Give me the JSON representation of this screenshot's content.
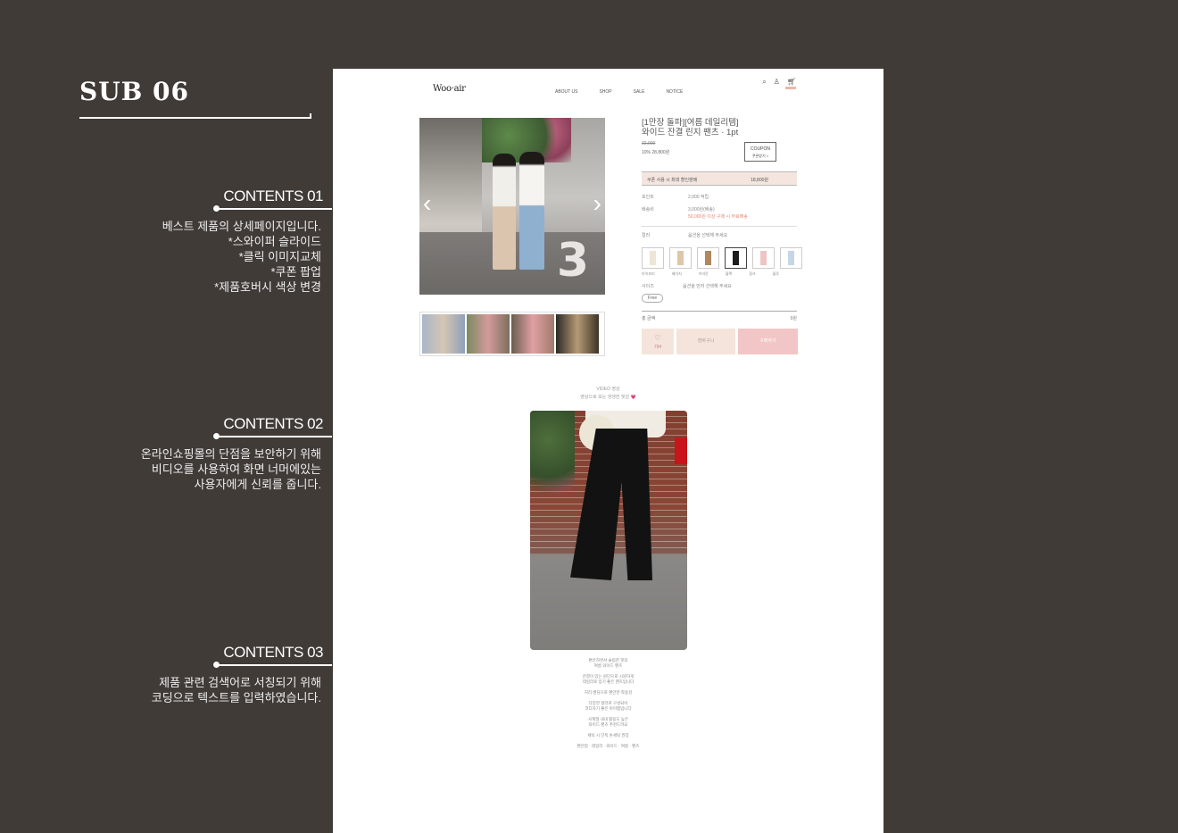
{
  "panel": {
    "title": "SUB 06",
    "sections": [
      {
        "heading": "CONTENTS 01",
        "lines": [
          "베스트 제품의 상세페이지입니다.",
          "*스와이퍼 슬라이드",
          "*클릭 이미지교체",
          "*쿠폰 팝업",
          "*제품호버시 색상 변경"
        ]
      },
      {
        "heading": "CONTENTS 02",
        "lines": [
          "온라인쇼핑몰의  단점을 보안하기 위해",
          "비디오를 사용하여 화면 너머에있는",
          "사용자에게 신뢰를 줍니다."
        ]
      },
      {
        "heading": "CONTENTS 03",
        "lines": [
          "제품 관련 검색어로 서칭되기 위해",
          "코딩으로 텍스트를 입력하였습니다."
        ]
      }
    ]
  },
  "site": {
    "logo": "Woo·air",
    "nav": [
      "ABOUT US",
      "SHOP",
      "SALE",
      "NOTICE"
    ],
    "icons": [
      "search-icon",
      "user-icon",
      "cart-icon"
    ]
  },
  "product": {
    "title_line1": "[1만장 돌파][여름 데일리템]",
    "title_line2": "와이드 잔결 린지 팬츠 · 1pt",
    "price_orig": "32,000",
    "price_sale": "10% 28,800원",
    "coupon_label": "COUPON",
    "coupon_sub": "쿠폰받기 >",
    "pink_bar_left": "쿠폰 사용 시 최대 할인판매",
    "pink_bar_right": "18,800원",
    "rows": [
      {
        "label": "포인트",
        "value": "2,000 적립"
      },
      {
        "label": "배송비",
        "value": "3,000원(배송)"
      }
    ],
    "row_note": "50,000원 이상 구매 시 무료배송",
    "color_label": "컬러",
    "color_value": "옵션을 선택해 주세요",
    "swatches": [
      {
        "name": "아이보리",
        "color": "#ede6d6"
      },
      {
        "name": "베이지",
        "color": "#dcc7a8"
      },
      {
        "name": "브라운",
        "color": "#b0875e"
      },
      {
        "name": "블랙",
        "color": "#1c1c1c"
      },
      {
        "name": "핑크",
        "color": "#eec4c4"
      },
      {
        "name": "블루",
        "color": "#c5d6e8"
      }
    ],
    "size_label": "사이즈",
    "size_value": "옵션을 먼저 선택해 주세요",
    "size_option": "Free",
    "total_label": "총 금액",
    "total_value": "0원",
    "wish_label": "♡",
    "wish_count": "794",
    "cart_label": "장바구니",
    "buy_label": "구매하기"
  },
  "video_section": {
    "title": "VIDEO 영상",
    "subtitle": "영상으로 보는 생생한 핏감 💗"
  },
  "description_lines": [
    "편안하면서 슬림한 핏의",
    "여름 와이드 팬츠",
    "",
    "잔결이 있는 원단으로 시원하게",
    "데일리로 입기 좋은 팬츠입니다",
    "",
    "허리 밴딩으로 편안한 착용감",
    "",
    "다양한 컬러로 구성되어",
    "코디하기 좋은 아이템입니다",
    "",
    "사계절 내내 활용도 높은",
    "와이드 팬츠 추천드려요",
    "",
    "세탁 시 단독 손세탁 권장",
    "",
    "편안함 · 데일리 · 와이드 · 여름 · 팬츠"
  ]
}
